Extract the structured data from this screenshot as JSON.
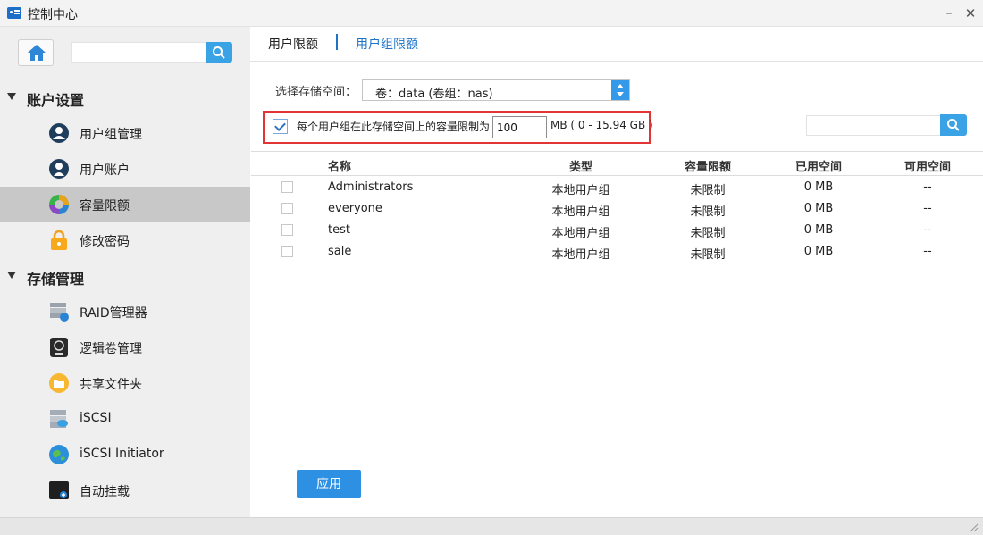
{
  "window": {
    "title": "控制中心"
  },
  "sidebar": {
    "search": {
      "placeholder": ""
    },
    "sections": [
      {
        "label": "账户设置",
        "items": [
          {
            "label": "用户组管理",
            "icon": "user-group-icon"
          },
          {
            "label": "用户账户",
            "icon": "user-account-icon"
          },
          {
            "label": "容量限额",
            "icon": "quota-pie-icon",
            "active": true
          },
          {
            "label": "修改密码",
            "icon": "lock-icon"
          }
        ]
      },
      {
        "label": "存储管理",
        "items": [
          {
            "label": "RAID管理器",
            "icon": "raid-icon"
          },
          {
            "label": "逻辑卷管理",
            "icon": "lvm-icon"
          },
          {
            "label": "共享文件夹",
            "icon": "shared-folder-icon"
          },
          {
            "label": "iSCSI",
            "icon": "iscsi-icon"
          },
          {
            "label": "iSCSI Initiator",
            "icon": "iscsi-initiator-icon"
          },
          {
            "label": "自动挂载",
            "icon": "automount-icon"
          }
        ]
      }
    ]
  },
  "tabs": [
    {
      "label": "用户限额",
      "active": true
    },
    {
      "label": "用户组限额",
      "active": false
    }
  ],
  "storage": {
    "label": "选择存储空间：",
    "selected": "卷：data (卷组：nas)"
  },
  "limit": {
    "checked": true,
    "text": "每个用户组在此存储空间上的容量限制为",
    "value": "100",
    "range": "MB ( 0 - 15.94 GB )"
  },
  "table": {
    "search_placeholder": "",
    "columns": [
      "名称",
      "类型",
      "容量限额",
      "已用空间",
      "可用空间"
    ],
    "rows": [
      {
        "name": "Administrators",
        "type": "本地用户组",
        "quota": "未限制",
        "used": "0 MB",
        "available": "--"
      },
      {
        "name": "everyone",
        "type": "本地用户组",
        "quota": "未限制",
        "used": "0 MB",
        "available": "--"
      },
      {
        "name": "test",
        "type": "本地用户组",
        "quota": "未限制",
        "used": "0 MB",
        "available": "--"
      },
      {
        "name": "sale",
        "type": "本地用户组",
        "quota": "未限制",
        "used": "0 MB",
        "available": "--"
      }
    ]
  },
  "apply_label": "应用",
  "colors": {
    "accent": "#2e90e3",
    "highlight_border": "#e23434",
    "active_nav": "#c8c8c8"
  }
}
